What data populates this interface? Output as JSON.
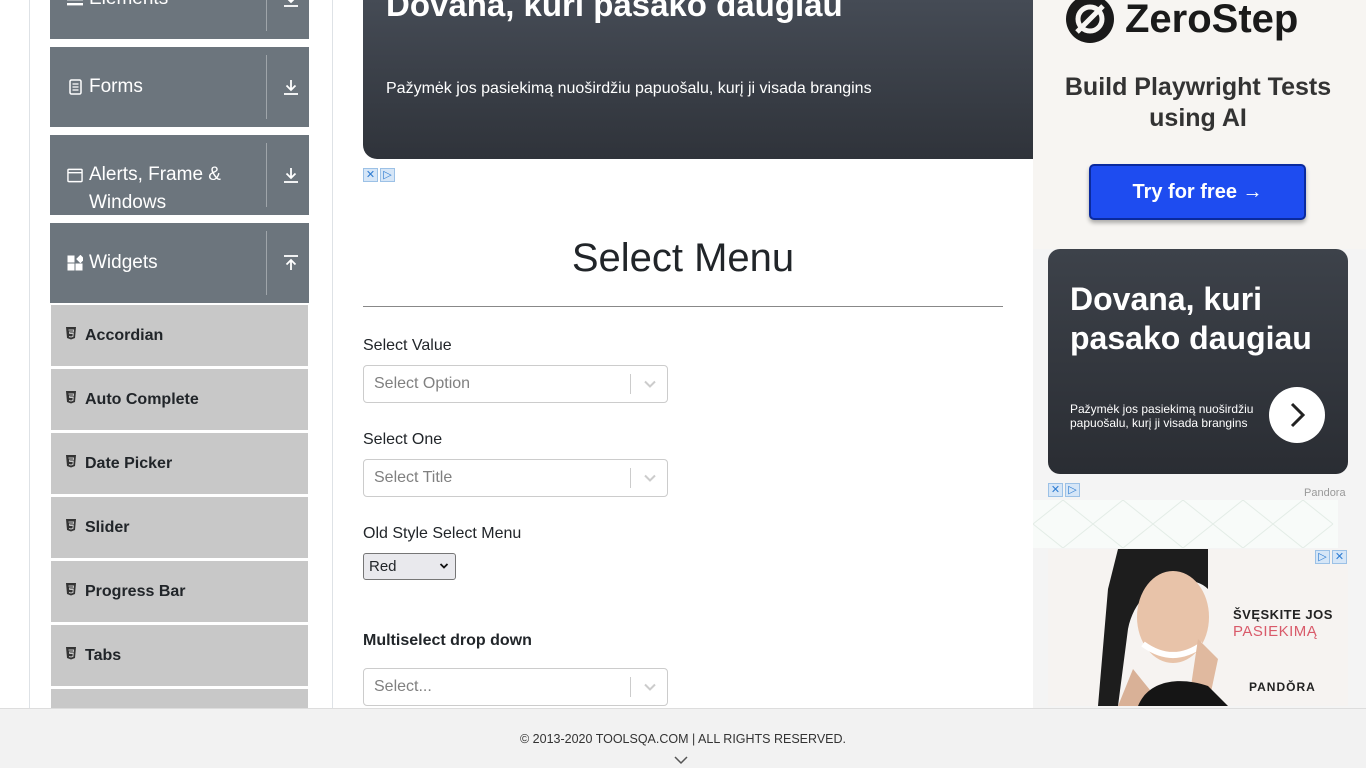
{
  "sidebar": {
    "groups": [
      {
        "label": "Elements",
        "icon": "menu-icon",
        "state": "collapsed"
      },
      {
        "label": "Forms",
        "icon": "document-icon",
        "state": "collapsed"
      },
      {
        "label": "Alerts, Frame & Windows",
        "icon": "window-icon",
        "state": "collapsed"
      },
      {
        "label": "Widgets",
        "icon": "widgets-icon",
        "state": "expanded"
      }
    ],
    "widget_items": [
      "Accordian",
      "Auto Complete",
      "Date Picker",
      "Slider",
      "Progress Bar",
      "Tabs"
    ]
  },
  "banner": {
    "title": "Dovana, kuri pasako daugiau",
    "subtitle": "Pažymėk jos pasiekimą nuoširdžiu papuošalu, kurį ji visada brangins"
  },
  "main": {
    "title": "Select Menu",
    "select_value": {
      "label": "Select Value",
      "placeholder": "Select Option"
    },
    "select_one": {
      "label": "Select One",
      "placeholder": "Select Title"
    },
    "old_style": {
      "label": "Old Style Select Menu",
      "value": "Red"
    },
    "multiselect": {
      "label": "Multiselect drop down",
      "placeholder": "Select..."
    }
  },
  "ads": {
    "zerostep": {
      "brand": "ZeroStep",
      "headline": "Build Playwright Tests using AI",
      "cta": "Try for free →"
    },
    "pandora_card": {
      "title": "Dovana, kuri pasako daugiau",
      "subtitle": "Pažymėk jos pasiekimą nuoširdžiu papuošalu, kurį ji visada brangins",
      "brand": "Pandora"
    },
    "photo_ad": {
      "line1": "ŠVĘSKITE JOS",
      "line2": "PASIEKIMĄ",
      "logo": "PANDŎRA"
    }
  },
  "footer": {
    "text": "© 2013-2020 TOOLSQA.COM | ALL RIGHTS RESERVED."
  },
  "colors": {
    "sidebar_group": "#6c757d",
    "sidebar_item": "#c8c8c8",
    "cta_blue": "#1e4cf0",
    "banner_dark": "#3a3f47"
  }
}
